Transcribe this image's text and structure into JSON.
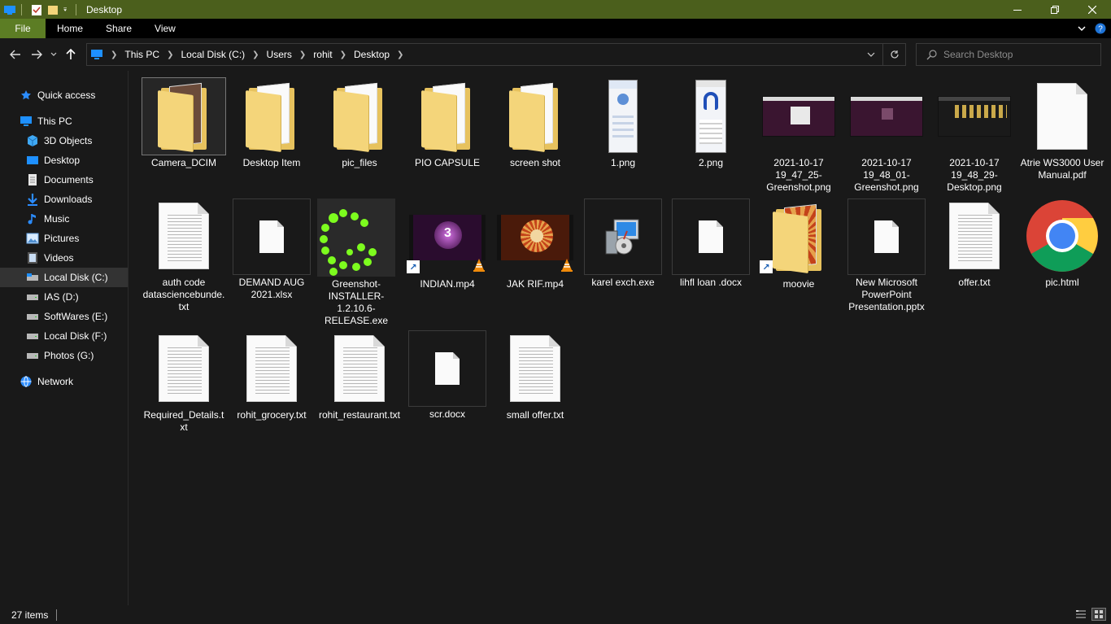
{
  "window": {
    "title": "Desktop"
  },
  "ribbon": {
    "tabs": [
      "File",
      "Home",
      "Share",
      "View"
    ]
  },
  "address": {
    "crumbs": [
      "This PC",
      "Local Disk (C:)",
      "Users",
      "rohit",
      "Desktop"
    ]
  },
  "search": {
    "placeholder": "Search Desktop"
  },
  "sidebar": {
    "items": [
      {
        "label": "Quick access",
        "icon": "star-icon"
      },
      {
        "label": "This PC",
        "icon": "computer-icon"
      },
      {
        "label": "3D Objects",
        "icon": "3d-objects-icon"
      },
      {
        "label": "Desktop",
        "icon": "desktop-icon"
      },
      {
        "label": "Documents",
        "icon": "documents-icon"
      },
      {
        "label": "Downloads",
        "icon": "download-icon"
      },
      {
        "label": "Music",
        "icon": "music-icon"
      },
      {
        "label": "Pictures",
        "icon": "pictures-icon"
      },
      {
        "label": "Videos",
        "icon": "videos-icon"
      },
      {
        "label": "Local Disk (C:)",
        "icon": "drive-icon"
      },
      {
        "label": "IAS (D:)",
        "icon": "drive-icon"
      },
      {
        "label": "SoftWares (E:)",
        "icon": "drive-icon"
      },
      {
        "label": "Local Disk (F:)",
        "icon": "drive-icon"
      },
      {
        "label": "Photos (G:)",
        "icon": "drive-icon"
      },
      {
        "label": "Network",
        "icon": "network-icon"
      }
    ]
  },
  "files": [
    {
      "name": "Camera_DCIM",
      "kind": "folder"
    },
    {
      "name": "Desktop Item",
      "kind": "folder"
    },
    {
      "name": "pic_files",
      "kind": "folder"
    },
    {
      "name": "PIO CAPSULE",
      "kind": "folder"
    },
    {
      "name": "screen shot",
      "kind": "folder"
    },
    {
      "name": "1.png",
      "kind": "png"
    },
    {
      "name": "2.png",
      "kind": "png"
    },
    {
      "name": "2021-10-17 19_47_25-Greenshot.png",
      "kind": "png"
    },
    {
      "name": "2021-10-17 19_48_01-Greenshot.png",
      "kind": "png"
    },
    {
      "name": "2021-10-17 19_48_29-Desktop.png",
      "kind": "png"
    },
    {
      "name": "Atrie WS3000 User Manual.pdf",
      "kind": "pdf"
    },
    {
      "name": "auth code datasciencebunde.txt",
      "kind": "txt"
    },
    {
      "name": "DEMAND AUG 2021.xlsx",
      "kind": "xlsx"
    },
    {
      "name": "Greenshot-INSTALLER-1.2.10.6-RELEASE.exe",
      "kind": "exe"
    },
    {
      "name": "INDIAN.mp4",
      "kind": "mp4"
    },
    {
      "name": "JAK RIF.mp4",
      "kind": "mp4"
    },
    {
      "name": "karel exch.exe",
      "kind": "exe"
    },
    {
      "name": "lihfl loan .docx",
      "kind": "docx"
    },
    {
      "name": "moovie",
      "kind": "shortcut"
    },
    {
      "name": "New Microsoft PowerPoint Presentation.pptx",
      "kind": "pptx"
    },
    {
      "name": "offer.txt",
      "kind": "txt"
    },
    {
      "name": "pic.html",
      "kind": "html"
    },
    {
      "name": "Required_Details.txt",
      "kind": "txt"
    },
    {
      "name": "rohit_grocery.txt",
      "kind": "txt"
    },
    {
      "name": "rohit_restaurant.txt",
      "kind": "txt"
    },
    {
      "name": "scr.docx",
      "kind": "docx"
    },
    {
      "name": "small offer.txt",
      "kind": "txt"
    }
  ],
  "status": {
    "count": "27 items"
  },
  "colors": {
    "titlebar": "#4b5f1c",
    "file_tab": "#5c7d24",
    "background": "#191919"
  }
}
